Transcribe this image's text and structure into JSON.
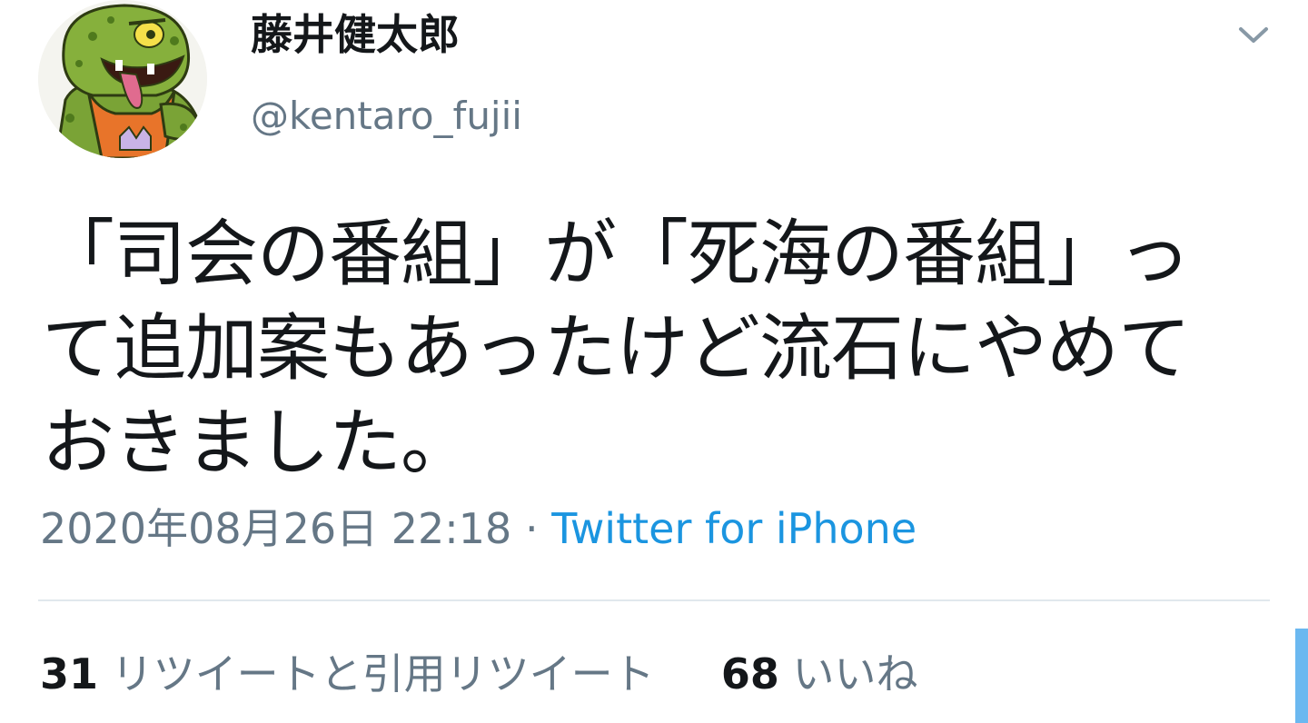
{
  "author": {
    "display_name": "藤井健太郎",
    "handle": "@kentaro_fujii",
    "avatar_icon": "cartoon-monster-avatar"
  },
  "tweet": {
    "text": "「司会の番組」が「死海の番組」っ\nて追加案もあったけど流石にやめて\nおきました。",
    "timestamp": "2020年08月26日 22:18",
    "separator": "·",
    "source": "Twitter for iPhone"
  },
  "stats": {
    "retweets_count": "31",
    "retweets_label": "リツイートと引用リツイート",
    "likes_count": "68",
    "likes_label": "いいね"
  },
  "colors": {
    "text": "#14171a",
    "secondary": "#657786",
    "link": "#1b95e0",
    "divider": "#e1e8ed",
    "scrollbar": "#6bb8f0"
  },
  "icons": {
    "menu": "chevron-down-icon"
  }
}
